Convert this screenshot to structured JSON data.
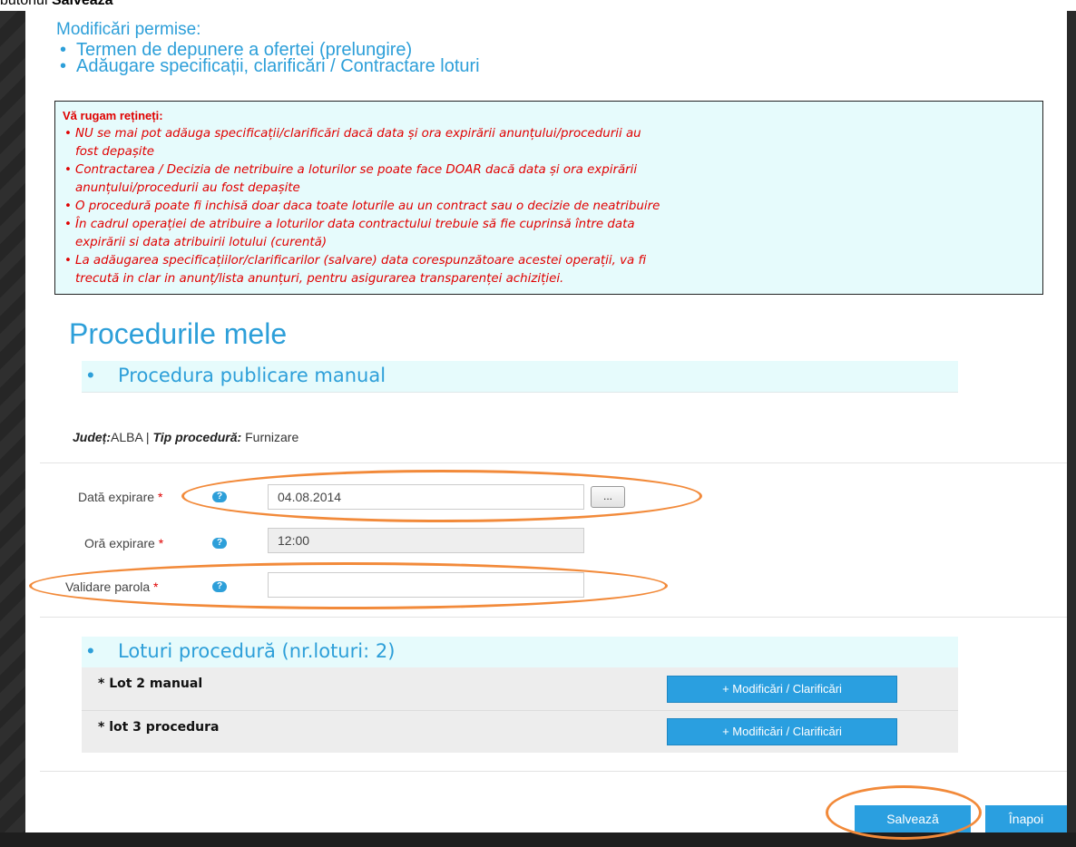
{
  "caption": {
    "prefix": "butonul ",
    "bold": "Salvează"
  },
  "permitted": {
    "title": "Modificări permise:",
    "items": [
      "Termen de depunere a ofertei (prelungire)",
      "Adăugare specificații, clarificări / Contractare loturi"
    ]
  },
  "notice": {
    "title": "Vă rugam rețineți:",
    "items": [
      "NU se mai pot adăuga specificații/clarificări dacă data și ora expirării anunțului/procedurii au",
      "fost depașite",
      "Contractarea / Decizia de netribuire a loturilor se poate face DOAR dacă data și ora expirării",
      "anunțului/procedurii au fost depașite",
      "O procedură poate fi inchisă doar daca toate loturile au un contract sau o decizie de neatribuire",
      "În cadrul operației de atribuire a loturilor data contractului trebuie să fie cuprinsă între data",
      "expirării si data atribuirii lotului (curentă)",
      "La adăugarea specificațiilor/clarificarilor (salvare) data corespunzătoare acestei operații, va fi",
      "trecută in clar in anunț/lista anunțuri, pentru asigurarea transparenței achiziției."
    ]
  },
  "page_title": "Procedurile mele",
  "procedure_section": "Procedura publicare manual",
  "meta": {
    "county_label": "Județ:",
    "county_value": "ALBA",
    "separator": "|",
    "type_label": "Tip procedură:",
    "type_value": "Furnizare"
  },
  "form": {
    "expiry_date_label": "Dată expirare",
    "expiry_date_value": "04.08.2014",
    "picker_label": "...",
    "expiry_time_label": "Oră expirare",
    "expiry_time_value": "12:00",
    "password_label": "Validare parola",
    "password_value": "",
    "required_mark": "*",
    "help_glyph": "?"
  },
  "lots_section": "Loturi procedură (nr.loturi: 2)",
  "lots": [
    {
      "name": "* Lot 2 manual",
      "button": "+ Modificări / Clarificări"
    },
    {
      "name": "* lot 3 procedura",
      "button": "+ Modificări / Clarificări"
    }
  ],
  "footer": {
    "save": "Salvează",
    "back": "Înapoi"
  },
  "colors": {
    "accent": "#2d9fd9",
    "button": "#2a9fe0",
    "notice_text": "#e00000",
    "highlight": "#f28a3a"
  }
}
